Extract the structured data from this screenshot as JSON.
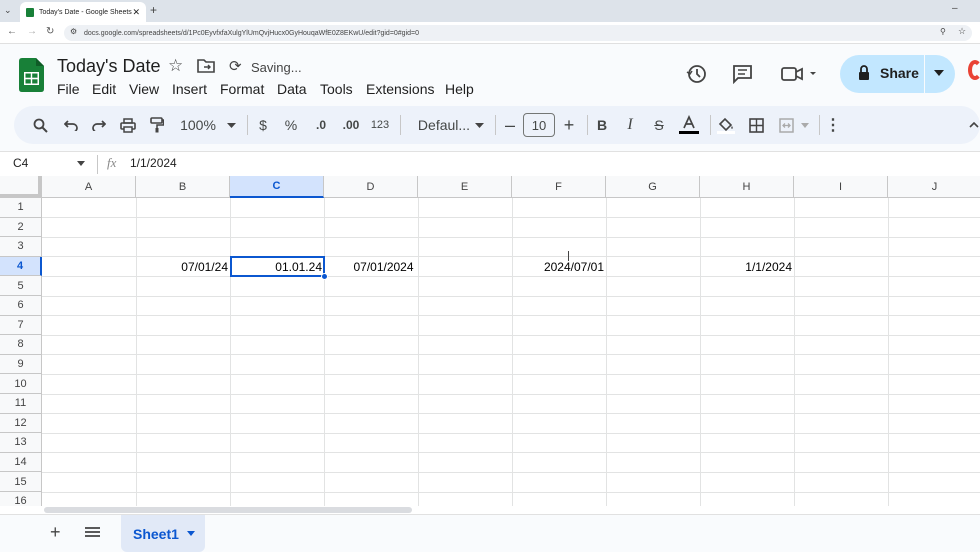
{
  "browser": {
    "tab_title": "Today's Date - Google Sheets",
    "url": "docs.google.com/spreadsheets/d/1Pc0EyvfxfaXulgYlUmQvjHucx0GyHouqaWfE0Z8EKwU/edit?gid=0#gid=0"
  },
  "doc": {
    "title": "Today's Date",
    "status": "Saving...",
    "share_label": "Share"
  },
  "menu": [
    "File",
    "Edit",
    "View",
    "Insert",
    "Format",
    "Data",
    "Tools",
    "Extensions",
    "Help"
  ],
  "toolbar": {
    "zoom": "100%",
    "currency": "$",
    "percent": "%",
    "dec_decrease": ".0",
    "dec_increase": ".00",
    "number_format": "123",
    "font": "Defaul...",
    "font_size": "10"
  },
  "formula_bar": {
    "name_box": "C4",
    "fx": "fx",
    "value": "1/1/2024"
  },
  "columns": [
    "A",
    "B",
    "C",
    "D",
    "E",
    "F",
    "G",
    "H",
    "I",
    "J"
  ],
  "rows": [
    "1",
    "2",
    "3",
    "4",
    "5",
    "6",
    "7",
    "8",
    "9",
    "10",
    "11",
    "12",
    "13",
    "14",
    "15",
    "16"
  ],
  "cells": {
    "B4": "07/01/24",
    "C4": "01.01.24",
    "D4": "07/01/2024",
    "F4": "2024/07/01",
    "H4": "1/1/2024"
  },
  "selected_cell": "C4",
  "sheet_tab": "Sheet1",
  "colors": {
    "accent": "#0b57d0",
    "share_bg": "#c2e7ff",
    "selected_header": "#d3e3fd",
    "sheets_green": "#188038"
  }
}
